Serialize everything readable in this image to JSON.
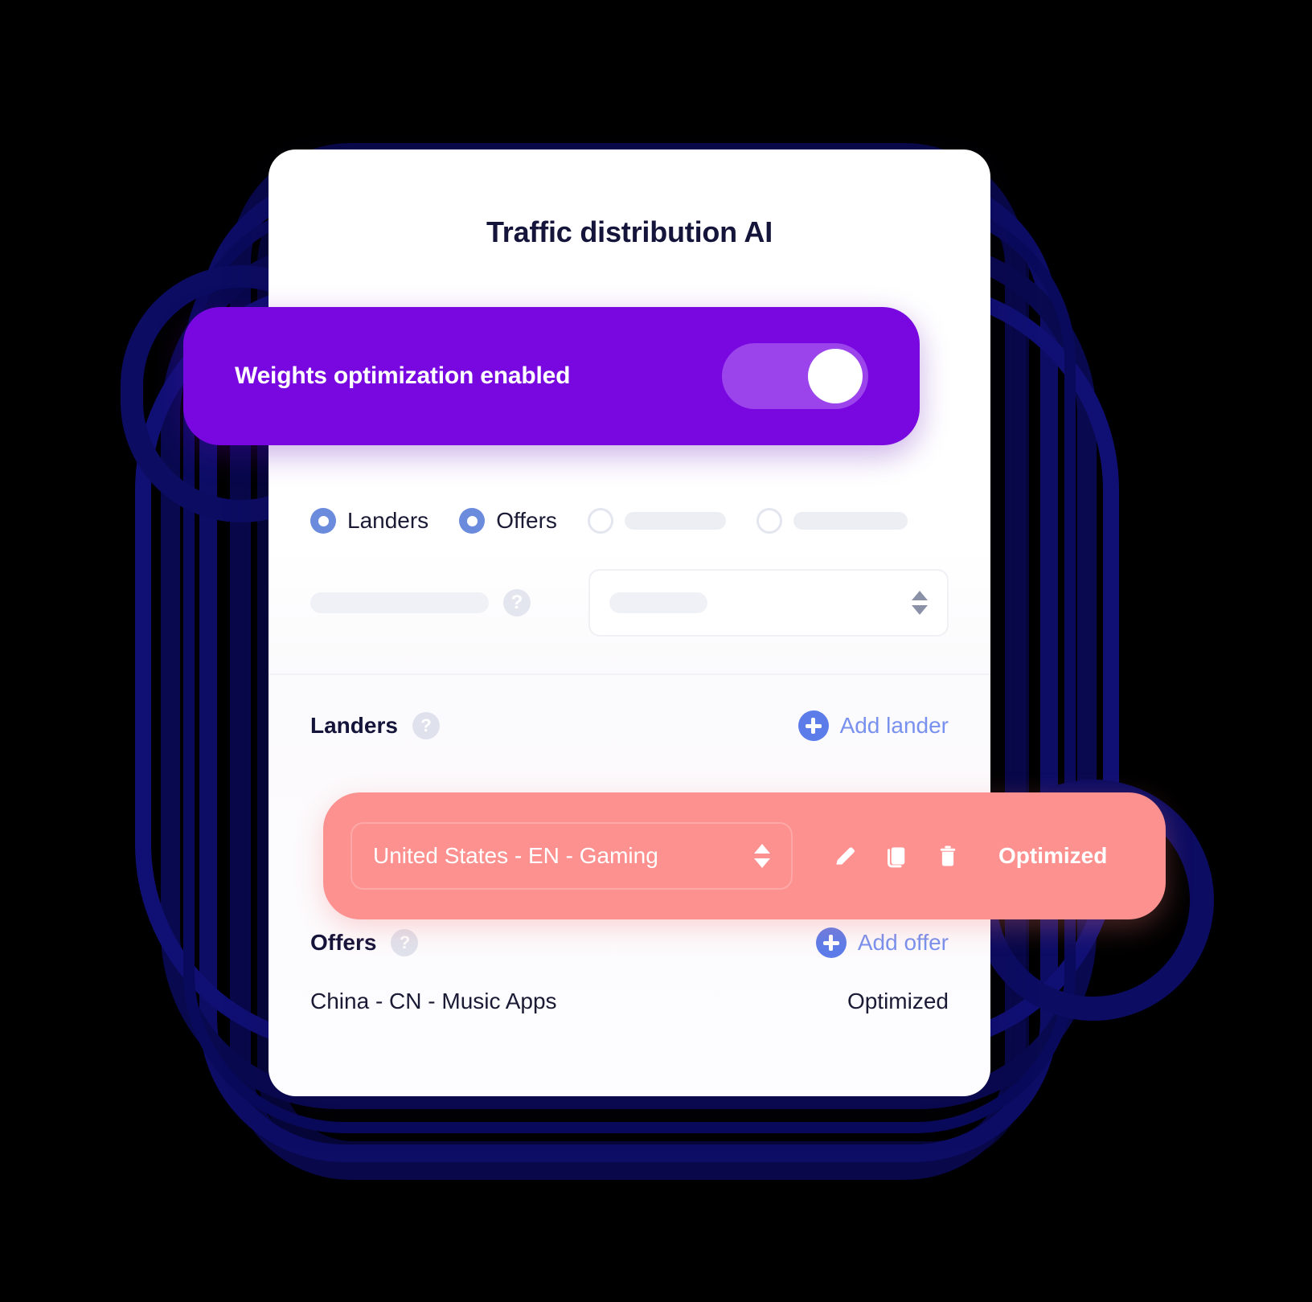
{
  "card": {
    "title": "Traffic distribution AI"
  },
  "optimization_banner": {
    "label": "Weights optimization enabled",
    "toggle_state": "on",
    "color": "#7908E0",
    "toggle_track_color": "#9B44EC"
  },
  "mode_radios": [
    {
      "label": "Landers",
      "selected": true
    },
    {
      "label": "Offers",
      "selected": true
    },
    {
      "label": "",
      "selected": false
    },
    {
      "label": "",
      "selected": false
    }
  ],
  "fields": {
    "help_glyph": "?",
    "stepper_up_glyph": "▲",
    "stepper_down_glyph": "▼"
  },
  "landers_section": {
    "title": "Landers",
    "help_glyph": "?",
    "add_label": "Add lander",
    "rows": [
      {
        "name": "United States - EN - Gaming",
        "status": "Optimized",
        "highlight_color": "#FC9190",
        "actions": [
          "edit-pencil",
          "duplicate-copy",
          "delete-trash"
        ]
      }
    ]
  },
  "offers_section": {
    "title": "Offers",
    "help_glyph": "?",
    "add_label": "Add offer",
    "rows": [
      {
        "name": "China - CN - Music Apps",
        "status": "Optimized"
      }
    ]
  },
  "theme": {
    "accent_blue": "#5C7CEA",
    "link_blue": "#7891EE",
    "text_dark": "#15143A",
    "background": "#000000",
    "ring_navy": "#0B0B52"
  }
}
